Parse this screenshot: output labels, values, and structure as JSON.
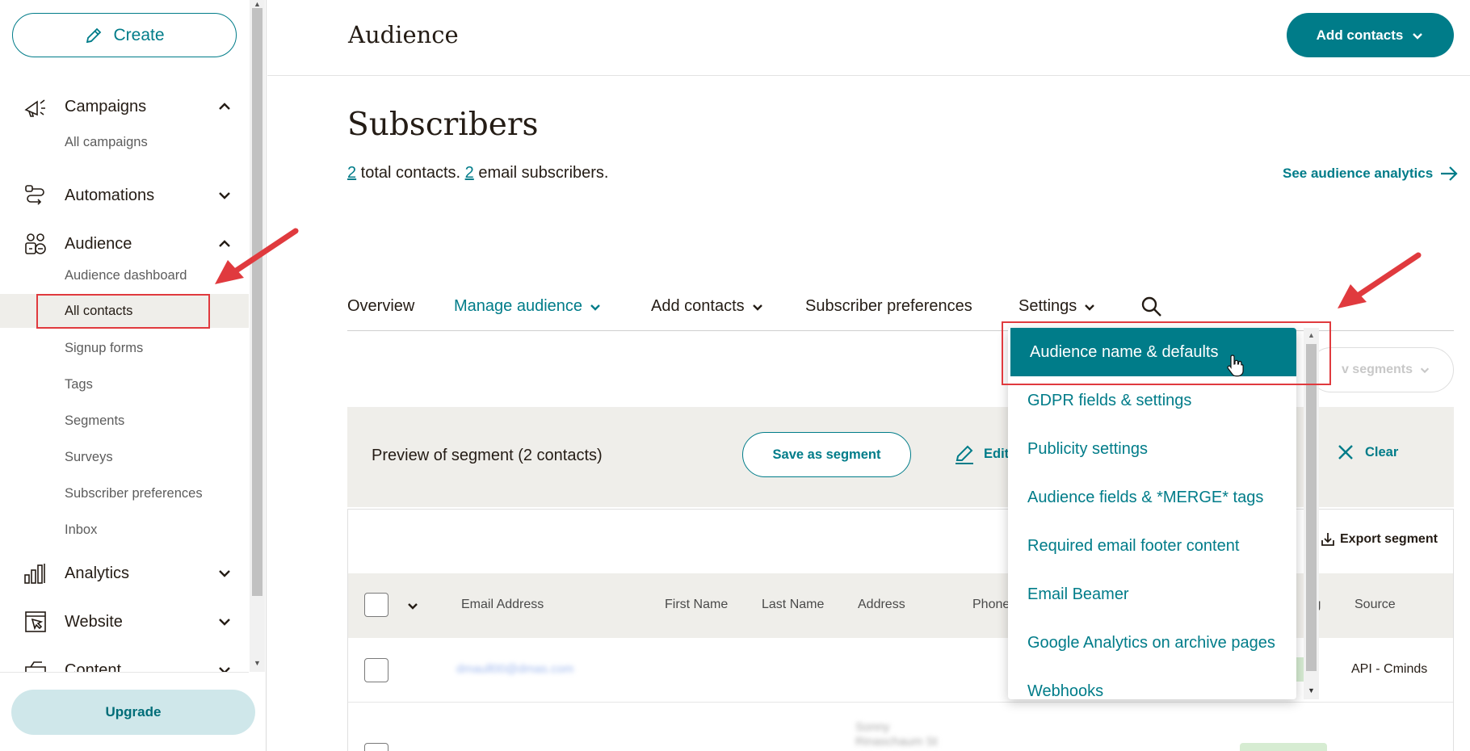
{
  "sidebar": {
    "create_label": "Create",
    "sections": [
      {
        "label": "Campaigns",
        "icon": "megaphone-icon",
        "expanded": true
      },
      {
        "label": "Automations",
        "icon": "automation-flow-icon",
        "expanded": false
      },
      {
        "label": "Audience",
        "icon": "audience-people-icon",
        "expanded": true
      },
      {
        "label": "Analytics",
        "icon": "bar-chart-icon",
        "expanded": false
      },
      {
        "label": "Website",
        "icon": "website-cursor-icon",
        "expanded": false
      },
      {
        "label": "Content",
        "icon": "content-icon",
        "expanded": false
      }
    ],
    "campaigns_items": [
      "All campaigns"
    ],
    "audience_items": [
      "Audience dashboard",
      "All contacts",
      "Signup forms",
      "Tags",
      "Segments",
      "Surveys",
      "Subscriber preferences",
      "Inbox"
    ],
    "active_item": "All contacts",
    "upgrade_label": "Upgrade"
  },
  "header": {
    "title": "Audience",
    "add_contacts_label": "Add contacts"
  },
  "main": {
    "title": "Subscribers",
    "summary": {
      "total_count": "2",
      "total_text": " total contacts. ",
      "email_count": "2",
      "email_text": " email subscribers."
    },
    "analytics_link": "See audience analytics",
    "tabs": [
      {
        "label": "Overview",
        "dropdown": false
      },
      {
        "label": "Manage audience",
        "dropdown": true
      },
      {
        "label": "Add contacts",
        "dropdown": true
      },
      {
        "label": "Subscriber preferences",
        "dropdown": false
      },
      {
        "label": "Settings",
        "dropdown": true
      }
    ],
    "segments_button_label": "v segments",
    "segment_bar": {
      "label": "Preview of segment (2 contacts)",
      "save_label": "Save as segment",
      "edit_label": "Edit s",
      "clear_label": "Clear"
    },
    "table": {
      "export_label": "Export segment",
      "columns": [
        "Email Address",
        "First Name",
        "Last Name",
        "Address",
        "Phone",
        "ing",
        "Source"
      ],
      "rows": [
        {
          "email": "dmaull00@dmas.com",
          "source": "API - Cminds"
        },
        {
          "address_line1": "Sonny",
          "address_line2": "Rinaschaum St"
        }
      ]
    }
  },
  "settings_menu": {
    "items": [
      "Audience name & defaults",
      "GDPR fields & settings",
      "Publicity settings",
      "Audience fields & *MERGE* tags",
      "Required email footer content",
      "Email Beamer",
      "Google Analytics on archive pages",
      "Webhooks"
    ],
    "selected": "Audience name & defaults"
  },
  "colors": {
    "accent": "#007c89",
    "annotation": "#e03a3e",
    "band": "#efeeea",
    "upgrade_bg": "#cfe7ea"
  }
}
